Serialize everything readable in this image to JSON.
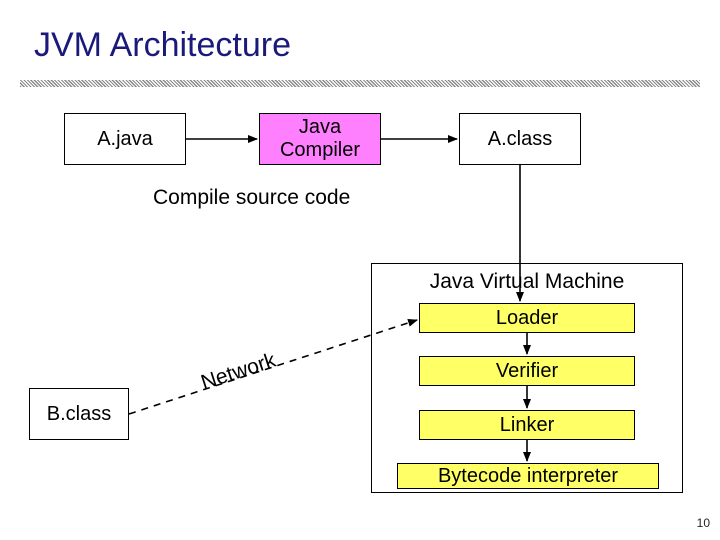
{
  "title": "JVM Architecture",
  "boxes": {
    "a_java": "A.java",
    "compiler": "Java\nCompiler",
    "a_class": "A.class",
    "b_class": "B.class",
    "loader": "Loader",
    "verifier": "Verifier",
    "linker": "Linker",
    "bytecode": "Bytecode interpreter"
  },
  "captions": {
    "compile": "Compile source code",
    "network": "Network",
    "jvm": "Java Virtual Machine"
  },
  "pagenum": "10",
  "chart_data": {
    "type": "diagram",
    "title": "JVM Architecture",
    "nodes": [
      {
        "id": "a_java",
        "label": "A.java"
      },
      {
        "id": "compiler",
        "label": "Java Compiler"
      },
      {
        "id": "a_class",
        "label": "A.class"
      },
      {
        "id": "b_class",
        "label": "B.class"
      },
      {
        "id": "jvm",
        "label": "Java Virtual Machine",
        "children": [
          "loader",
          "verifier",
          "linker",
          "bytecode"
        ]
      },
      {
        "id": "loader",
        "label": "Loader"
      },
      {
        "id": "verifier",
        "label": "Verifier"
      },
      {
        "id": "linker",
        "label": "Linker"
      },
      {
        "id": "bytecode",
        "label": "Bytecode interpreter"
      }
    ],
    "edges": [
      {
        "from": "a_java",
        "to": "compiler",
        "style": "solid"
      },
      {
        "from": "compiler",
        "to": "a_class",
        "style": "solid"
      },
      {
        "from": "a_class",
        "to": "loader",
        "style": "solid",
        "note": "down into JVM"
      },
      {
        "from": "b_class",
        "to": "loader",
        "style": "dashed",
        "label": "Network"
      },
      {
        "from": "loader",
        "to": "verifier",
        "style": "solid"
      },
      {
        "from": "verifier",
        "to": "linker",
        "style": "solid"
      },
      {
        "from": "linker",
        "to": "bytecode",
        "style": "solid"
      }
    ],
    "annotations": [
      {
        "text": "Compile source code",
        "near": [
          "a_java",
          "compiler",
          "a_class"
        ]
      }
    ]
  }
}
